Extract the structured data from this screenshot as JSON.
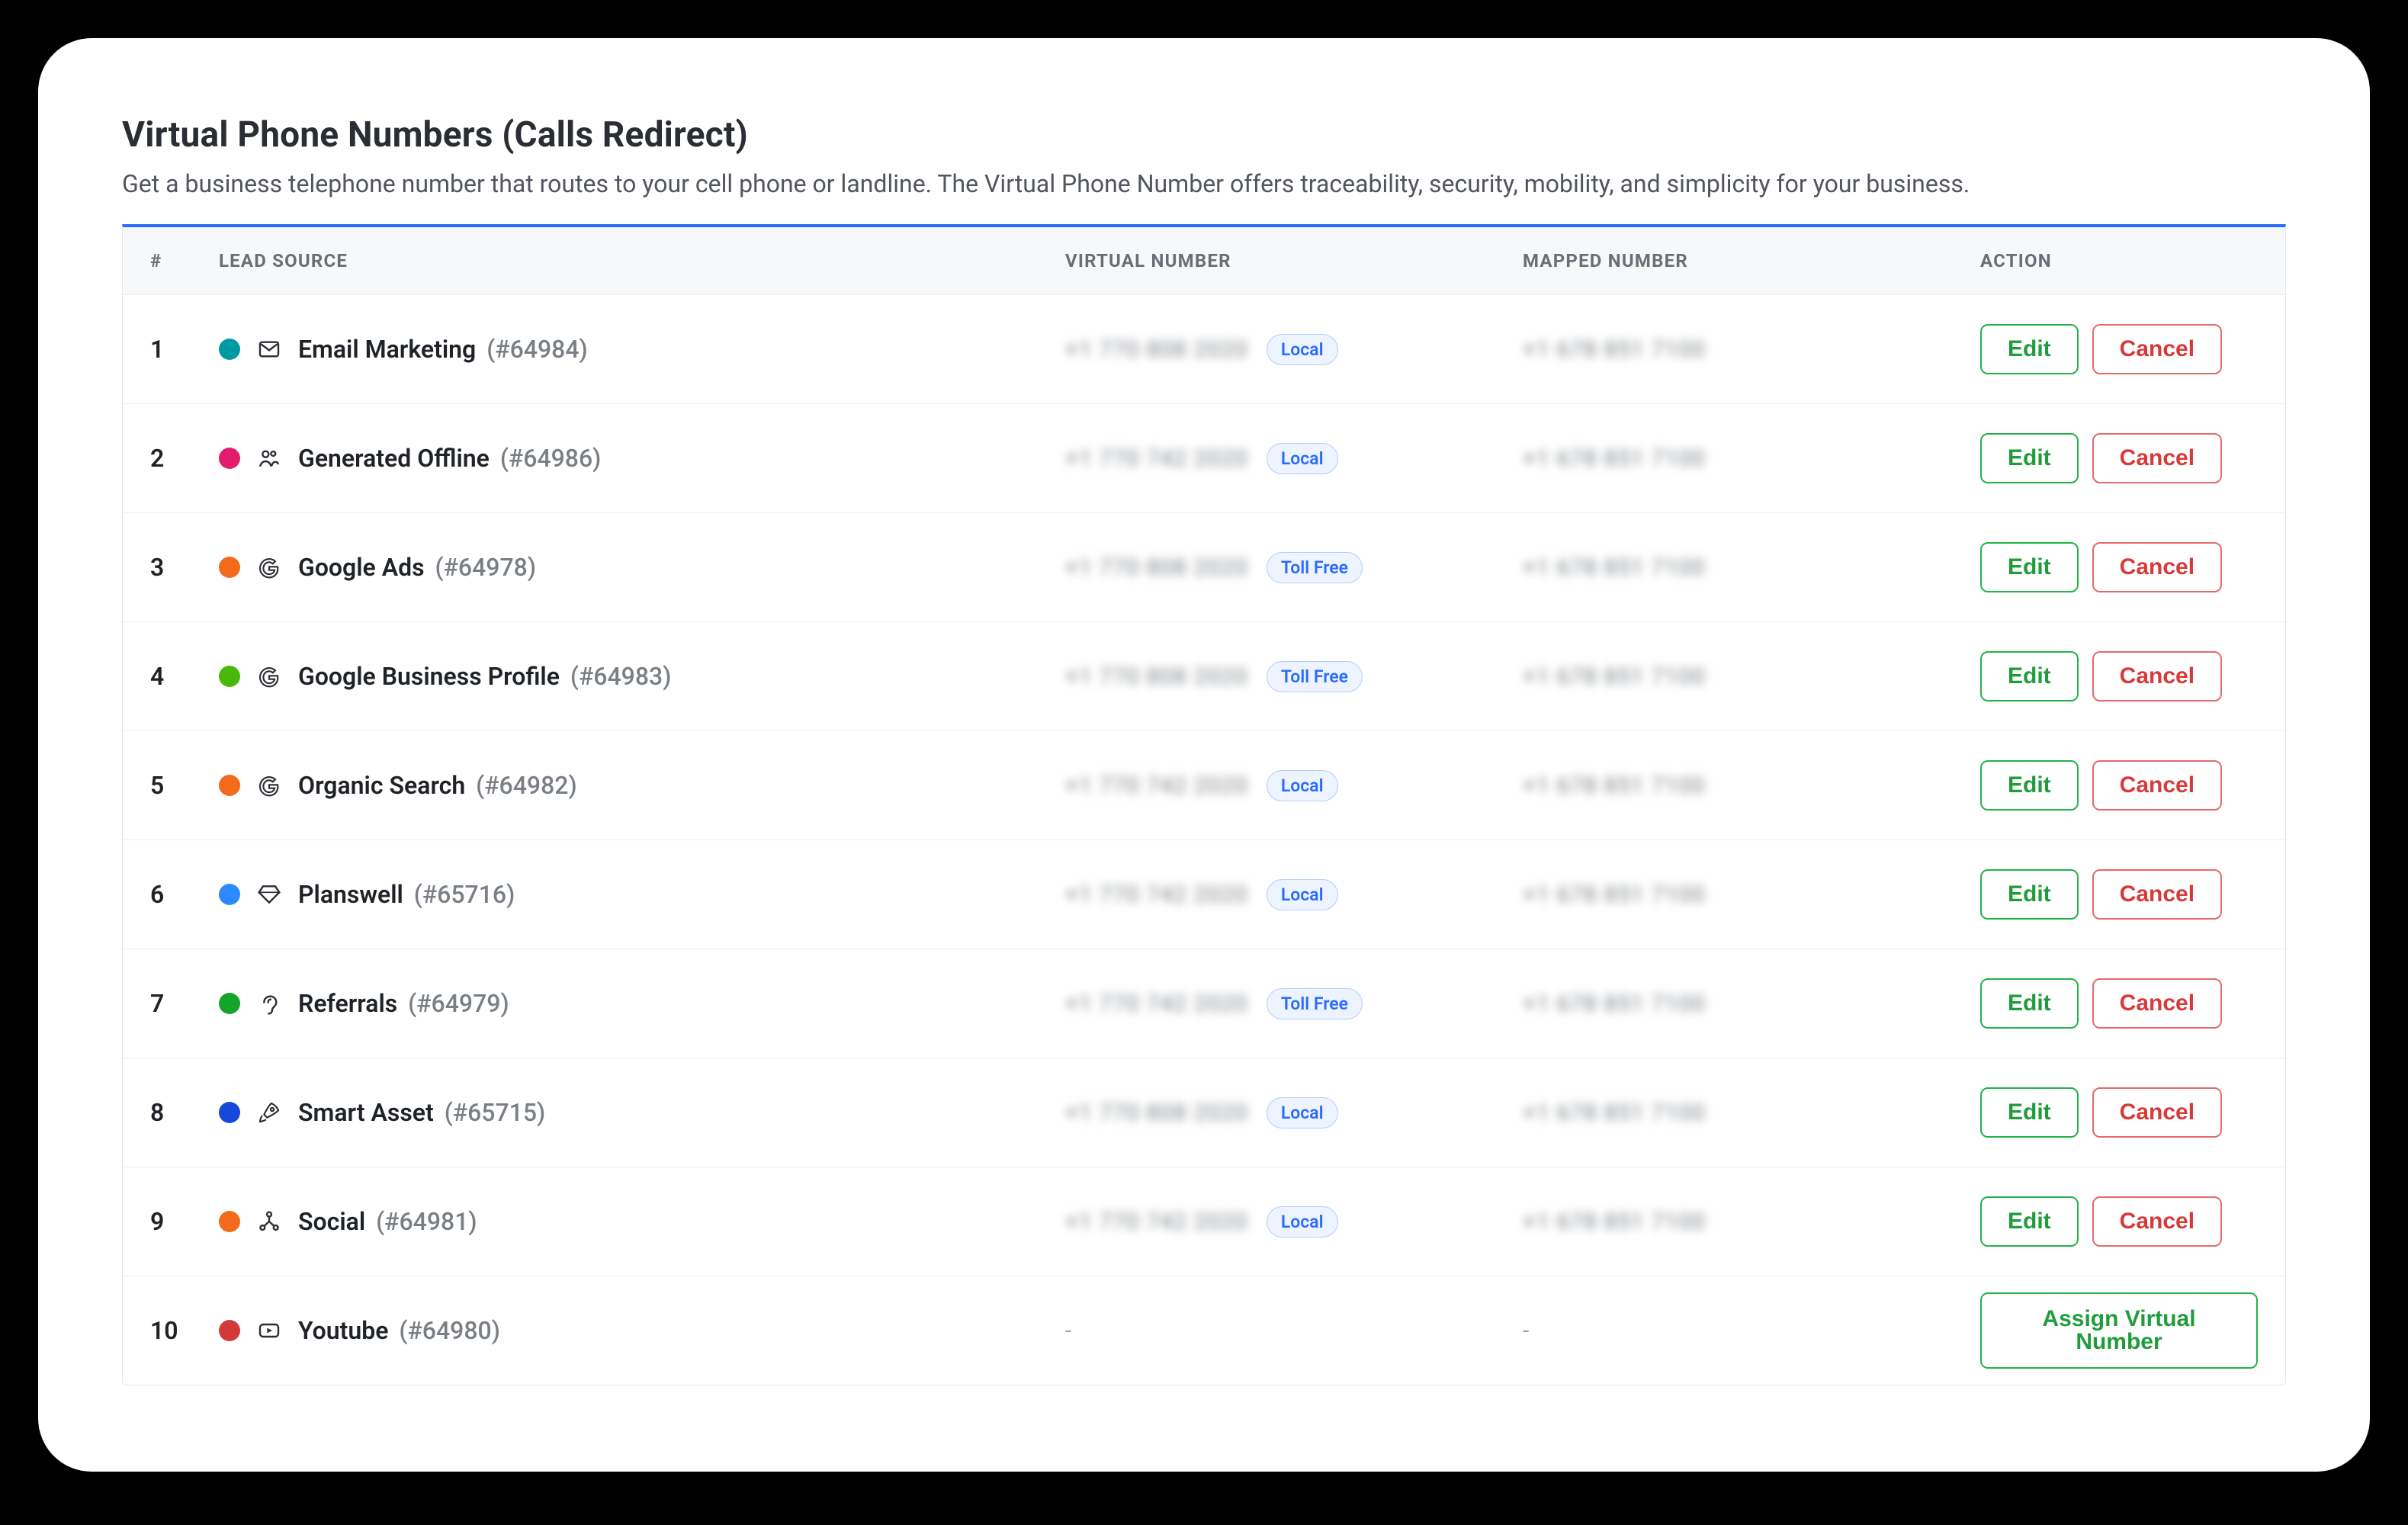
{
  "header": {
    "title": "Virtual Phone Numbers (Calls Redirect)",
    "subtitle": "Get a business telephone number that routes to your cell phone or landline. The Virtual Phone Number offers traceability, security, mobility, and simplicity for your business."
  },
  "table": {
    "columns": {
      "index": "#",
      "lead_source": "LEAD SOURCE",
      "virtual_number": "VIRTUAL NUMBER",
      "mapped_number": "MAPPED NUMBER",
      "action": "ACTION"
    },
    "actions": {
      "edit": "Edit",
      "cancel": "Cancel",
      "assign": "Assign Virtual Number"
    },
    "number_types": {
      "local": "Local",
      "toll_free": "Toll Free"
    },
    "rows": [
      {
        "idx": "1",
        "source": "Email Marketing",
        "sid": "(#64984)",
        "icon": "mail",
        "dot": "#009aa2",
        "vn_blur": "+1 770 808 2020",
        "mn_blur": "+1 678 851 7100",
        "type": "local",
        "has_number": true
      },
      {
        "idx": "2",
        "source": "Generated Offline",
        "sid": "(#64986)",
        "icon": "users",
        "dot": "#e41b6f",
        "vn_blur": "+1 770 742 2020",
        "mn_blur": "+1 678 851 7100",
        "type": "local",
        "has_number": true
      },
      {
        "idx": "3",
        "source": "Google Ads",
        "sid": "(#64978)",
        "icon": "google",
        "dot": "#f26a1b",
        "vn_blur": "+1 770 808 2020",
        "mn_blur": "+1 678 851 7100",
        "type": "toll_free",
        "has_number": true
      },
      {
        "idx": "4",
        "source": "Google Business Profile",
        "sid": "(#64983)",
        "icon": "google",
        "dot": "#4ab80b",
        "vn_blur": "+1 770 808 2020",
        "mn_blur": "+1 678 851 7100",
        "type": "toll_free",
        "has_number": true
      },
      {
        "idx": "5",
        "source": "Organic Search",
        "sid": "(#64982)",
        "icon": "google",
        "dot": "#f26a1b",
        "vn_blur": "+1 770 742 2020",
        "mn_blur": "+1 678 851 7100",
        "type": "local",
        "has_number": true
      },
      {
        "idx": "6",
        "source": "Planswell",
        "sid": "(#65716)",
        "icon": "diamond",
        "dot": "#2d89ff",
        "vn_blur": "+1 770 742 2020",
        "mn_blur": "+1 678 851 7100",
        "type": "local",
        "has_number": true
      },
      {
        "idx": "7",
        "source": "Referrals",
        "sid": "(#64979)",
        "icon": "ear",
        "dot": "#15a42a",
        "vn_blur": "+1 770 742 2020",
        "mn_blur": "+1 678 851 7100",
        "type": "toll_free",
        "has_number": true
      },
      {
        "idx": "8",
        "source": "Smart Asset",
        "sid": "(#65715)",
        "icon": "rocket",
        "dot": "#1648d9",
        "vn_blur": "+1 770 808 2020",
        "mn_blur": "+1 678 851 7100",
        "type": "local",
        "has_number": true
      },
      {
        "idx": "9",
        "source": "Social",
        "sid": "(#64981)",
        "icon": "share",
        "dot": "#f26a1b",
        "vn_blur": "+1 770 742 2020",
        "mn_blur": "+1 678 851 7100",
        "type": "local",
        "has_number": true
      },
      {
        "idx": "10",
        "source": "Youtube",
        "sid": "(#64980)",
        "icon": "youtube",
        "dot": "#d23a3a",
        "vn_blur": "-",
        "mn_blur": "-",
        "type": null,
        "has_number": false
      }
    ]
  }
}
